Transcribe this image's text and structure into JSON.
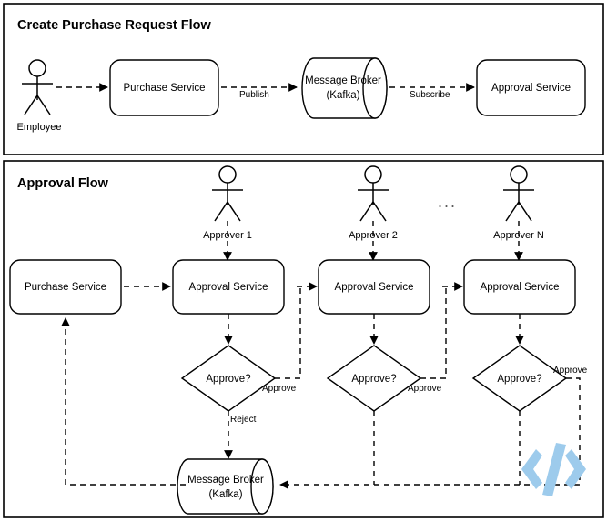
{
  "diagram": {
    "panels": [
      {
        "id": "create-purchase-request-flow",
        "title": "Create Purchase Request Flow",
        "actors": [
          {
            "id": "employee",
            "label": "Employee"
          }
        ],
        "nodes": [
          {
            "id": "purchase-service",
            "label": "Purchase Service",
            "shape": "rounded-rect"
          },
          {
            "id": "message-broker",
            "label_line1": "Message Broker",
            "label_line2": "(Kafka)",
            "shape": "cylinder"
          },
          {
            "id": "approval-service",
            "label": "Approval Service",
            "shape": "rounded-rect"
          }
        ],
        "edges": [
          {
            "from": "employee",
            "to": "purchase-service",
            "label": "",
            "style": "dashed"
          },
          {
            "from": "purchase-service",
            "to": "message-broker",
            "label": "Publish",
            "style": "dashed"
          },
          {
            "from": "message-broker",
            "to": "approval-service",
            "label": "Subscribe",
            "style": "dashed"
          }
        ]
      },
      {
        "id": "approval-flow",
        "title": "Approval Flow",
        "ellipsis": "...",
        "actors": [
          {
            "id": "approver-1",
            "label": "Approver 1"
          },
          {
            "id": "approver-2",
            "label": "Approver 2"
          },
          {
            "id": "approver-n",
            "label": "Approver N"
          }
        ],
        "nodes": [
          {
            "id": "purchase-service",
            "label": "Purchase Service",
            "shape": "rounded-rect"
          },
          {
            "id": "approval-service-1",
            "label": "Approval Service",
            "shape": "rounded-rect"
          },
          {
            "id": "approval-service-2",
            "label": "Approval Service",
            "shape": "rounded-rect"
          },
          {
            "id": "approval-service-n",
            "label": "Approval Service",
            "shape": "rounded-rect"
          },
          {
            "id": "decision-1",
            "label": "Approve?",
            "shape": "diamond"
          },
          {
            "id": "decision-2",
            "label": "Approve?",
            "shape": "diamond"
          },
          {
            "id": "decision-n",
            "label": "Approve?",
            "shape": "diamond"
          },
          {
            "id": "message-broker",
            "label_line1": "Message Broker",
            "label_line2": "(Kafka)",
            "shape": "cylinder"
          }
        ],
        "edge_labels": {
          "approve_1": "Approve",
          "approve_2": "Approve",
          "approve_n": "Approve",
          "reject_1": "Reject"
        }
      }
    ],
    "watermark": {
      "name": "code-icon",
      "color": "#9dcbec"
    },
    "colors": {
      "stroke": "#000000",
      "background": "#ffffff",
      "watermark": "#9dcbec",
      "ellipsis": "#595959"
    }
  }
}
